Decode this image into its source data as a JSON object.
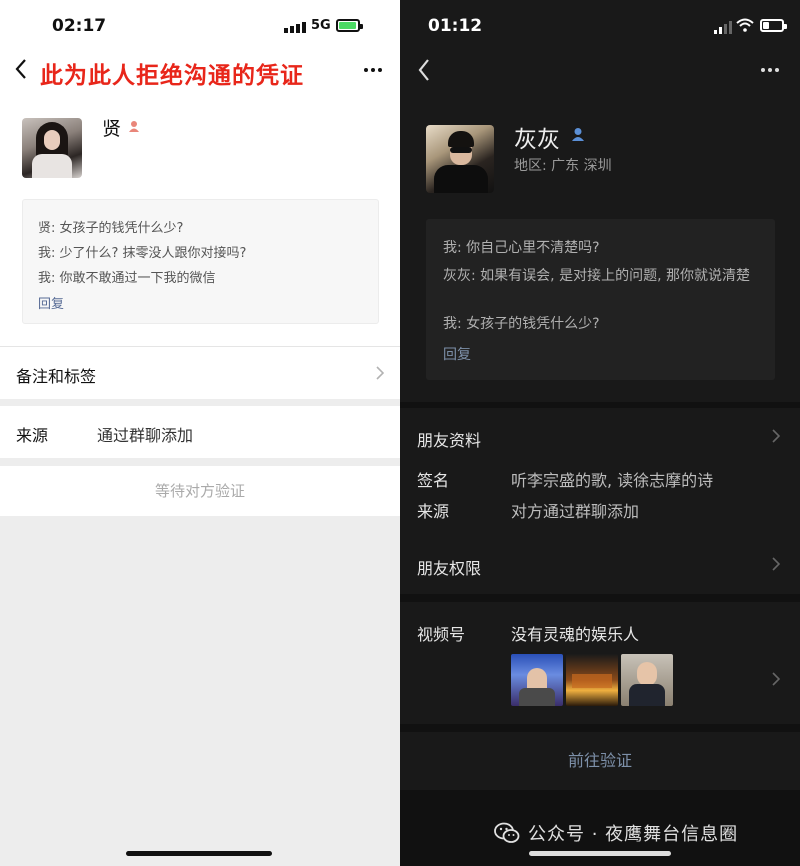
{
  "left": {
    "status": {
      "time": "02:17",
      "network": "5G"
    },
    "title": "此为此人拒绝沟通的凭证",
    "profile": {
      "name": "贤"
    },
    "messages": [
      "贤: 女孩子的钱凭什么少?",
      "我: 少了什么? 抹零没人跟你对接吗?",
      "我: 你敢不敢通过一下我的微信"
    ],
    "reply": "回复",
    "rows": {
      "notes_label": "备注和标签",
      "source_label": "来源",
      "source_value": "通过群聊添加"
    },
    "verify": "等待对方验证",
    "colors": {
      "title_red": "#e8261a",
      "link_blue": "#576b95"
    }
  },
  "right": {
    "status": {
      "time": "01:12"
    },
    "profile": {
      "name": "灰灰",
      "region": "地区: 广东 深圳"
    },
    "messages": [
      "我: 你自己心里不清楚吗?",
      "灰灰: 如果有误会, 是对接上的问题, 那你就说清楚",
      "我: 女孩子的钱凭什么少?"
    ],
    "reply": "回复",
    "friend_info": {
      "label": "朋友资料",
      "signature_label": "签名",
      "signature_value": "听李宗盛的歌, 读徐志摩的诗",
      "source_label": "来源",
      "source_value": "对方通过群聊添加"
    },
    "permissions": "朋友权限",
    "channels": {
      "label": "视频号",
      "value": "没有灵魂的娱乐人"
    },
    "verify": "前往验证",
    "watermark": "公众号 · 夜鹰舞台信息圈",
    "colors": {
      "link_blue": "#7d90a9"
    }
  }
}
